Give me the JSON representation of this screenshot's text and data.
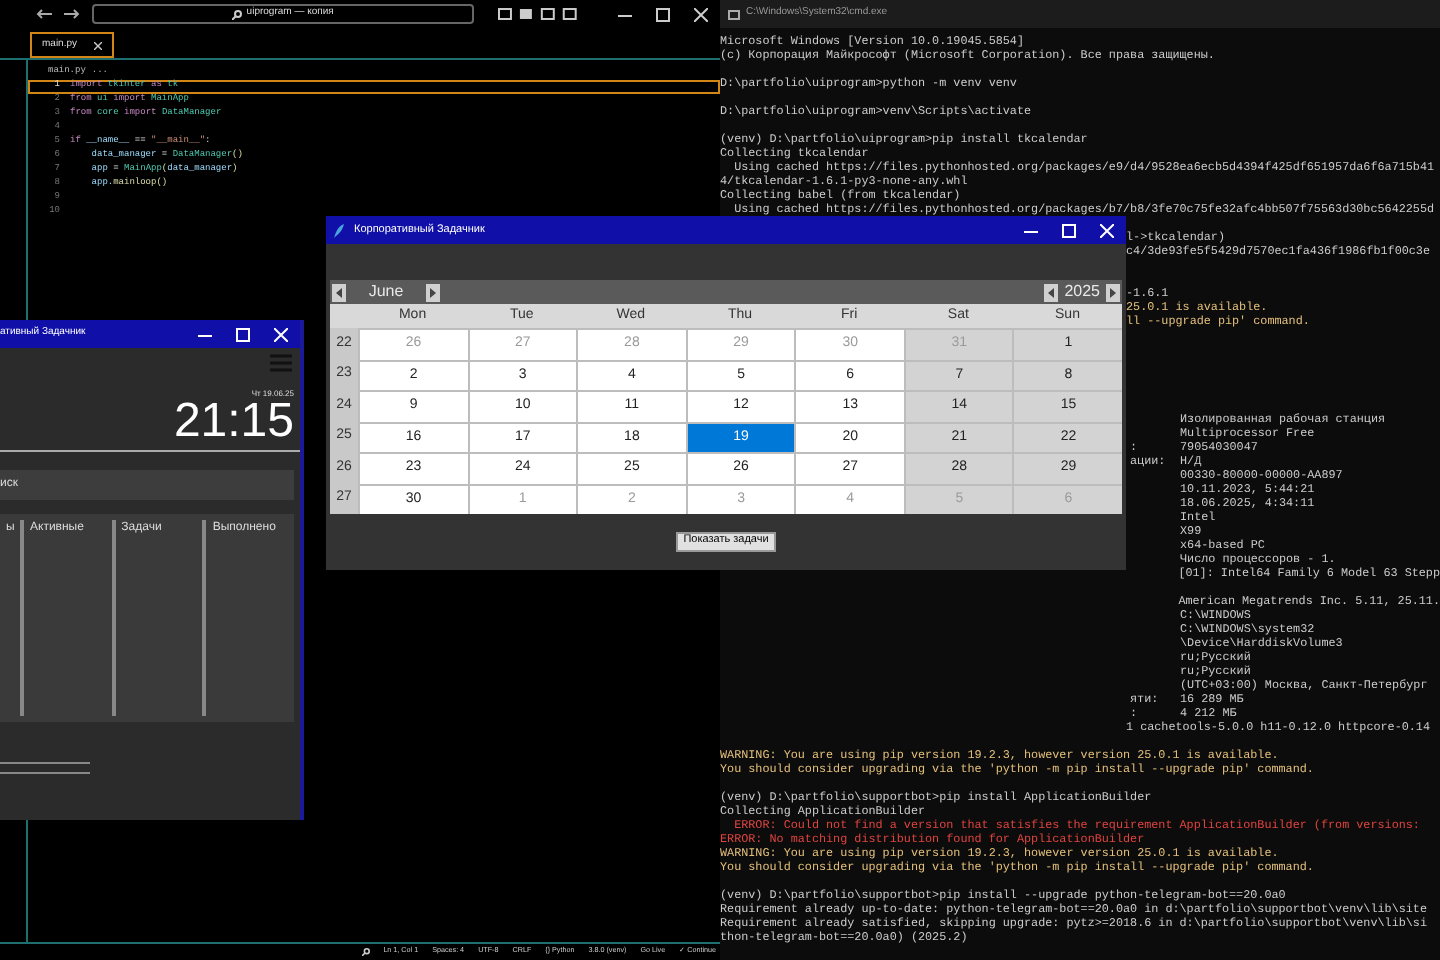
{
  "editor": {
    "search": "uiprogram — копия",
    "tab": {
      "label": "main.py",
      "selected": true
    },
    "breadcrumb": [
      "main.py",
      "..."
    ],
    "code_lines": [
      {
        "number": "1",
        "current": true,
        "tokens": [
          {
            "kind": "kw",
            "text": "import "
          },
          {
            "kind": "mod",
            "text": "tkinter "
          },
          {
            "kind": "kw",
            "text": "as "
          },
          {
            "kind": "mod",
            "text": "tk"
          }
        ]
      },
      {
        "number": "2",
        "current": false,
        "tokens": [
          {
            "kind": "kw",
            "text": "from "
          },
          {
            "kind": "mod",
            "text": "ui "
          },
          {
            "kind": "kw",
            "text": "import "
          },
          {
            "kind": "mod",
            "text": "MainApp"
          }
        ]
      },
      {
        "number": "3",
        "current": false,
        "tokens": [
          {
            "kind": "kw",
            "text": "from "
          },
          {
            "kind": "mod",
            "text": "core "
          },
          {
            "kind": "kw",
            "text": "import "
          },
          {
            "kind": "mod",
            "text": "DataManager"
          }
        ]
      },
      {
        "number": "4",
        "current": false
      },
      {
        "number": "5",
        "current": false,
        "tokens": [
          {
            "kind": "kw",
            "text": "if "
          },
          {
            "kind": "var",
            "text": "__name__ "
          },
          {
            "kind": "op",
            "text": "== "
          },
          {
            "kind": "str",
            "text": "\"__main__\""
          },
          {
            "kind": "op",
            "text": ":"
          }
        ]
      },
      {
        "number": "6",
        "current": false,
        "tokens": [
          {
            "kind": "var",
            "text": "    data_manager "
          },
          {
            "kind": "op",
            "text": "= "
          },
          {
            "kind": "mod",
            "text": "DataManager"
          },
          {
            "kind": "fn",
            "text": "()"
          }
        ]
      },
      {
        "number": "7",
        "current": false,
        "tokens": [
          {
            "kind": "var",
            "text": "    app "
          },
          {
            "kind": "op",
            "text": "= "
          },
          {
            "kind": "mod",
            "text": "MainApp"
          },
          {
            "kind": "fn",
            "text": "("
          },
          {
            "kind": "var",
            "text": "data_manager"
          },
          {
            "kind": "fn",
            "text": ")"
          }
        ]
      },
      {
        "number": "8",
        "current": false,
        "tokens": [
          {
            "kind": "var",
            "text": "    app."
          },
          {
            "kind": "fn",
            "text": "mainloop()"
          }
        ]
      },
      {
        "number": "9",
        "current": false
      },
      {
        "number": "10",
        "current": false
      }
    ],
    "status_bar": [
      "Ln 1, Col 1",
      "Spaces: 4",
      "UTF-8",
      "CRLF",
      "{} Python",
      "3.8.0 (venv)",
      "Go Live",
      "✓ Continue"
    ]
  },
  "terminal": {
    "title": "C:\\Windows\\System32\\cmd.exe",
    "sections": [
      {
        "kind": "full",
        "lines": [
          {
            "kind": "text",
            "text": "Microsoft Windows [Version 10.0.19045.5854]"
          },
          {
            "kind": "text",
            "text": "(c) Корпорация Майкрософт (Microsoft Corporation). Все права защищены."
          },
          {
            "kind": "blank"
          },
          {
            "kind": "text",
            "text": "D:\\partfolio\\uiprogram>python -m venv venv"
          },
          {
            "kind": "blank"
          },
          {
            "kind": "text",
            "text": "D:\\partfolio\\uiprogram>venv\\Scripts\\activate"
          },
          {
            "kind": "blank"
          },
          {
            "kind": "text",
            "text": "(venv) D:\\partfolio\\uiprogram>pip install tkcalendar"
          },
          {
            "kind": "text",
            "text": "Collecting tkcalendar"
          },
          {
            "kind": "text",
            "text": "  Using cached https://files.pythonhosted.org/packages/e9/d4/9528ea6ecb5d4394f425df651957da6f6a715b41"
          },
          {
            "kind": "text",
            "text": "4/tkcalendar-1.6.1-py3-none-any.whl"
          },
          {
            "kind": "text",
            "text": "Collecting babel (from tkcalendar)"
          },
          {
            "kind": "text",
            "text": "  Using cached https://files.pythonhosted.org/packages/b7/b8/3fe70c75fe32afc4bb507f75563d30bc5642255d"
          }
        ]
      },
      {
        "kind": "fragment",
        "lines": [
          {
            "kind": "blank"
          },
          {
            "kind": "text",
            "text": "l->tkcalendar)"
          },
          {
            "kind": "text",
            "text": "c4/3de93fe5f5429d7570ec1fa436f1986fb1f00c3e"
          },
          {
            "kind": "blank"
          },
          {
            "kind": "blank"
          },
          {
            "kind": "text",
            "text": "-1.6.1"
          },
          {
            "kind": "warning",
            "text": "25.0.1 is available."
          },
          {
            "kind": "warning",
            "text": "ll --upgrade pip' command."
          },
          {
            "kind": "blank"
          },
          {
            "kind": "blank"
          },
          {
            "kind": "blank"
          },
          {
            "kind": "blank"
          },
          {
            "kind": "blank"
          },
          {
            "kind": "blank"
          }
        ]
      },
      {
        "kind": "table",
        "rows": [
          {
            "value": "Изолированная рабочая станция"
          },
          {
            "value": "Multiprocessor Free"
          },
          {
            "label": ":",
            "value": "79054030047"
          },
          {
            "label": "ации:",
            "value": "Н/Д"
          },
          {
            "value": "00330-80000-00000-AA897"
          },
          {
            "value": "10.11.2023, 5:44:21"
          },
          {
            "value": "18.06.2025, 4:34:11"
          },
          {
            "value": "Intel"
          },
          {
            "value": "X99"
          },
          {
            "value": "x64-based PC"
          },
          {
            "value": "Число процессоров - 1."
          },
          {
            "value": "[01]: Intel64 Family 6 Model 63 Stepp"
          },
          {},
          {
            "value": "American Megatrends Inc. 5.11, 25.11."
          },
          {
            "value": "C:\\WINDOWS"
          },
          {
            "value": "C:\\WINDOWS\\system32"
          },
          {
            "value": "\\Device\\HarddiskVolume3"
          },
          {
            "value": "ru;Русский"
          },
          {
            "value": "ru;Русский"
          },
          {
            "value": "(UTC+03:00) Москва, Санкт-Петербург"
          },
          {
            "label": "яти:",
            "value": "16 289 МБ"
          },
          {
            "label": ":",
            "value": "4 212 МБ"
          }
        ]
      },
      {
        "kind": "fragment",
        "lines": [
          {
            "kind": "text",
            "text": "1 cachetools-5.0.0 h11-0.12.0 httpcore-0.14"
          }
        ]
      },
      {
        "kind": "full",
        "lines": [
          {
            "kind": "blank"
          },
          {
            "kind": "warning",
            "text": "WARNING: You are using pip version 19.2.3, however version 25.0.1 is available."
          },
          {
            "kind": "warning",
            "text": "You should consider upgrading via the 'python -m pip install --upgrade pip' command."
          },
          {
            "kind": "blank"
          },
          {
            "kind": "text",
            "text": "(venv) D:\\partfolio\\supportbot>pip install ApplicationBuilder"
          },
          {
            "kind": "text",
            "text": "Collecting ApplicationBuilder"
          },
          {
            "kind": "error",
            "text": "  ERROR: Could not find a version that satisfies the requirement ApplicationBuilder (from versions:"
          },
          {
            "kind": "error",
            "text": "ERROR: No matching distribution found for ApplicationBuilder"
          },
          {
            "kind": "warning",
            "text": "WARNING: You are using pip version 19.2.3, however version 25.0.1 is available."
          },
          {
            "kind": "warning",
            "text": "You should consider upgrading via the 'python -m pip install --upgrade pip' command."
          },
          {
            "kind": "blank"
          },
          {
            "kind": "text",
            "text": "(venv) D:\\partfolio\\supportbot>pip install --upgrade python-telegram-bot==20.0a0"
          },
          {
            "kind": "text",
            "text": "Requirement already up-to-date: python-telegram-bot==20.0a0 in d:\\partfolio\\supportbot\\venv\\lib\\site"
          },
          {
            "kind": "text",
            "text": "Requirement already satisfied, skipping upgrade: pytz>=2018.6 in d:\\partfolio\\supportbot\\venv\\lib\\si"
          },
          {
            "kind": "text",
            "text": "thon-telegram-bot==20.0a0) (2025.2)"
          }
        ]
      }
    ]
  },
  "task_app": {
    "title": "ативный Задачник",
    "date": "Чт 19.06.25",
    "clock": "21:15",
    "search": "иск",
    "columns": [
      "ы",
      "Активные",
      "Задачи",
      "Выполнено"
    ]
  },
  "calendar_window": {
    "title": "Корпоративный Задачник",
    "month": "June",
    "year": "2025",
    "weekdays": [
      "Mon",
      "Tue",
      "Wed",
      "Thu",
      "Fri",
      "Sat",
      "Sun"
    ],
    "weeks": [
      {
        "number": "22",
        "days": [
          {
            "t": "26",
            "other": true,
            "selected": false
          },
          {
            "t": "27",
            "other": true,
            "selected": false
          },
          {
            "t": "28",
            "other": true,
            "selected": false
          },
          {
            "t": "29",
            "other": true,
            "selected": false
          },
          {
            "t": "30",
            "other": true,
            "selected": false
          },
          {
            "t": "31",
            "other": true,
            "selected": false
          },
          {
            "t": "1",
            "other": false,
            "selected": false
          }
        ]
      },
      {
        "number": "23",
        "days": [
          {
            "t": "2",
            "other": false,
            "selected": false
          },
          {
            "t": "3",
            "other": false,
            "selected": false
          },
          {
            "t": "4",
            "other": false,
            "selected": false
          },
          {
            "t": "5",
            "other": false,
            "selected": false
          },
          {
            "t": "6",
            "other": false,
            "selected": false
          },
          {
            "t": "7",
            "other": false,
            "selected": false
          },
          {
            "t": "8",
            "other": false,
            "selected": false
          }
        ]
      },
      {
        "number": "24",
        "days": [
          {
            "t": "9",
            "other": false,
            "selected": false
          },
          {
            "t": "10",
            "other": false,
            "selected": false
          },
          {
            "t": "11",
            "other": false,
            "selected": false
          },
          {
            "t": "12",
            "other": false,
            "selected": false
          },
          {
            "t": "13",
            "other": false,
            "selected": false
          },
          {
            "t": "14",
            "other": false,
            "selected": false
          },
          {
            "t": "15",
            "other": false,
            "selected": false
          }
        ]
      },
      {
        "number": "25",
        "days": [
          {
            "t": "16",
            "other": false,
            "selected": false
          },
          {
            "t": "17",
            "other": false,
            "selected": false
          },
          {
            "t": "18",
            "other": false,
            "selected": false
          },
          {
            "t": "19",
            "other": false,
            "selected": true
          },
          {
            "t": "20",
            "other": false,
            "selected": false
          },
          {
            "t": "21",
            "other": false,
            "selected": false
          },
          {
            "t": "22",
            "other": false,
            "selected": false
          }
        ]
      },
      {
        "number": "26",
        "days": [
          {
            "t": "23",
            "other": false,
            "selected": false
          },
          {
            "t": "24",
            "other": false,
            "selected": false
          },
          {
            "t": "25",
            "other": false,
            "selected": false
          },
          {
            "t": "26",
            "other": false,
            "selected": false
          },
          {
            "t": "27",
            "other": false,
            "selected": false
          },
          {
            "t": "28",
            "other": false,
            "selected": false
          },
          {
            "t": "29",
            "other": false,
            "selected": false
          }
        ]
      },
      {
        "number": "27",
        "days": [
          {
            "t": "30",
            "other": false,
            "selected": false
          },
          {
            "t": "1",
            "other": true,
            "selected": false
          },
          {
            "t": "2",
            "other": true,
            "selected": false
          },
          {
            "t": "3",
            "other": true,
            "selected": false
          },
          {
            "t": "4",
            "other": true,
            "selected": false
          },
          {
            "t": "5",
            "other": true,
            "selected": false
          },
          {
            "t": "6",
            "other": true,
            "selected": false
          }
        ]
      }
    ],
    "button": "Показать задачи"
  }
}
